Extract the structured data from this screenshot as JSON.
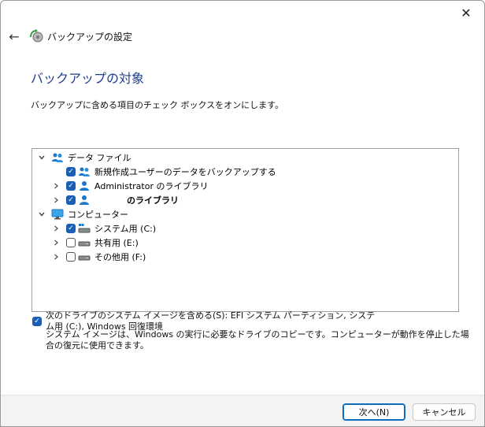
{
  "window": {
    "title": "バックアップの設定",
    "close_glyph": "✕",
    "back_glyph": "←"
  },
  "page": {
    "title": "バックアップの対象",
    "instruction": "バックアップに含める項目のチェック ボックスをオンにします。"
  },
  "tree": [
    {
      "label": "データ ファイル",
      "expander": "expanded",
      "checkbox": "none",
      "icon": "users-icon",
      "level": 0
    },
    {
      "label": "新規作成ユーザーのデータをバックアップする",
      "expander": "none",
      "checkbox": "checked",
      "icon": "users-icon",
      "level": 1
    },
    {
      "label": "Administrator のライブラリ",
      "expander": "collapsed",
      "checkbox": "checked",
      "icon": "user-icon",
      "level": 1
    },
    {
      "label": "のライブラリ",
      "expander": "collapsed",
      "checkbox": "checked",
      "icon": "user-icon",
      "level": 1
    },
    {
      "label": "コンピューター",
      "expander": "expanded",
      "checkbox": "none",
      "icon": "computer-icon",
      "level": 0
    },
    {
      "label": "システム用 (C:)",
      "expander": "collapsed",
      "checkbox": "checked",
      "icon": "drive-windows-icon",
      "level": 1
    },
    {
      "label": "共有用 (E:)",
      "expander": "collapsed",
      "checkbox": "unchecked",
      "icon": "drive-icon",
      "level": 1
    },
    {
      "label": "その他用 (F:)",
      "expander": "collapsed",
      "checkbox": "unchecked",
      "icon": "drive-icon",
      "level": 1
    }
  ],
  "system_image": {
    "checked": true,
    "label": "次のドライブのシステム イメージを含める(S): EFI システム パーティション, システム用 (C:), Windows 回復環境",
    "description": "システム イメージは、Windows の実行に必要なドライブのコピーです。コンピューターが動作を停止した場合の復元に使用できます。"
  },
  "buttons": {
    "next": "次へ(N)",
    "cancel": "キャンセル"
  },
  "colors": {
    "accent": "#1b5fb4",
    "title_blue": "#1f3d8c",
    "footer_bg": "#f3f3f3"
  }
}
